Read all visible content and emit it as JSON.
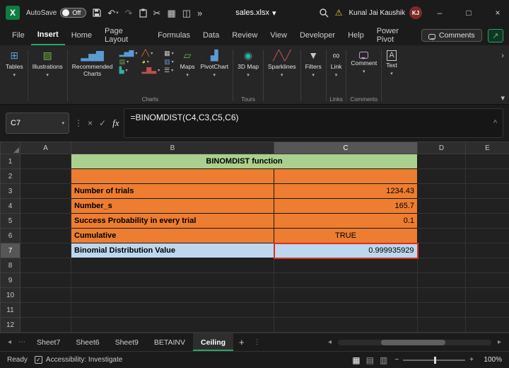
{
  "titlebar": {
    "autosave_label": "AutoSave",
    "autosave_state": "Off",
    "filename": "sales.xlsx",
    "user_name": "Kunal Jai Kaushik",
    "user_initials": "KJ"
  },
  "ribbon_tabs": [
    "File",
    "Insert",
    "Home",
    "Page Layout",
    "Formulas",
    "Data",
    "Review",
    "View",
    "Developer",
    "Help",
    "Power Pivot"
  ],
  "active_tab": "Insert",
  "tab_row": {
    "comments_label": "Comments"
  },
  "ribbon": {
    "tables": "Tables",
    "illustrations": "Illustrations",
    "recommended_charts": "Recommended Charts",
    "maps": "Maps",
    "pivotchart": "PivotChart",
    "map3d": "3D Map",
    "sparklines": "Sparklines",
    "filters": "Filters",
    "link": "Link",
    "comment": "Comment",
    "text": "Text",
    "group_charts": "Charts",
    "group_tours": "Tours",
    "group_links": "Links",
    "group_comments": "Comments"
  },
  "formula_bar": {
    "name_box": "C7",
    "formula": "=BINOMDIST(C4,C3,C5,C6)"
  },
  "grid": {
    "column_headers": [
      "A",
      "B",
      "C",
      "D",
      "E"
    ],
    "row_headers": [
      "1",
      "2",
      "3",
      "4",
      "5",
      "6",
      "7",
      "8",
      "9",
      "10",
      "11",
      "12"
    ],
    "selected_cell": "C7",
    "cells": {
      "b1": "BINOMDIST function",
      "b3": "Number of trials",
      "c3": "1234.43",
      "b4": "Number_s",
      "c4": "165.7",
      "b5": "Success Probability in every trial",
      "c5": "0.1",
      "b6": "Cumulative",
      "c6": "TRUE",
      "b7": "Binomial Distribution Value",
      "c7": "0.999935929"
    }
  },
  "sheet_tabs": {
    "tabs": [
      "Sheet7",
      "Sheet6",
      "Sheet9",
      "BETAINV",
      "Ceiling"
    ],
    "active": "Ceiling"
  },
  "status_bar": {
    "mode": "Ready",
    "accessibility": "Accessibility: Investigate",
    "zoom_level": "100%"
  },
  "colors": {
    "excel_green": "#21A366",
    "header_fill_green": "#A9D08E",
    "input_fill_orange": "#ED7D31",
    "result_fill_blue": "#BDD7EE",
    "highlight_red": "#D93025"
  }
}
